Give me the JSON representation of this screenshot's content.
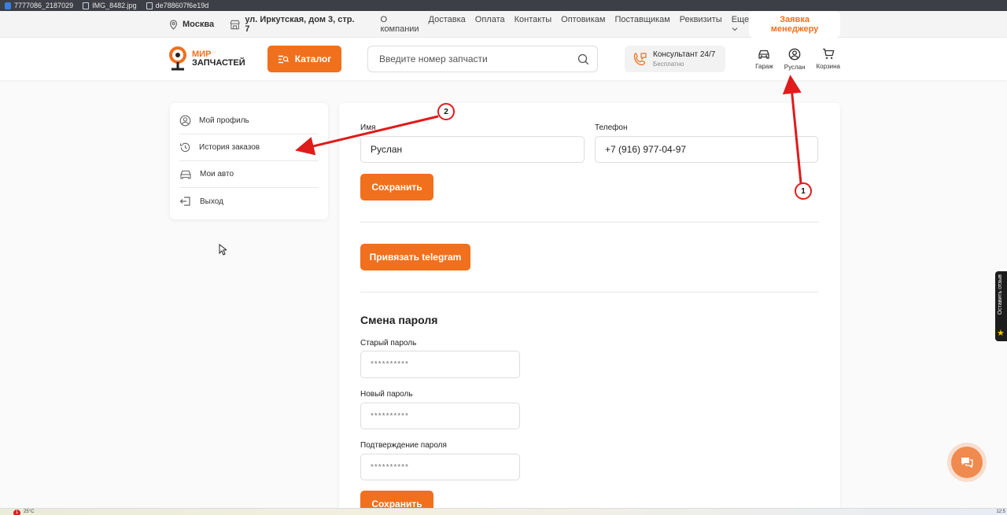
{
  "browser_tabs": [
    {
      "label": "7777086_2187029",
      "icon": "app-icon"
    },
    {
      "label": "IMG_8482.jpg",
      "icon": "file-icon"
    },
    {
      "label": "de788607f6e19d",
      "icon": "file-icon"
    }
  ],
  "topbar": {
    "city": "Москва",
    "address": "ул. Иркутская, дом 3, стр. 7",
    "links": [
      "О компании",
      "Доставка",
      "Оплата",
      "Контакты",
      "Оптовикам",
      "Поставщикам",
      "Реквизиты",
      "Еще"
    ],
    "manager_button": "Заявка менеджеру"
  },
  "header": {
    "logo_line1": "МИР",
    "logo_line2": "ЗАПЧАСТЕЙ",
    "catalog_button": "Каталог",
    "search_placeholder": "Введите номер запчасти",
    "consultant_title": "Консультант 24/7",
    "consultant_subtitle": "Бесплатно",
    "garage_label": "Гараж",
    "user_label": "Руслан",
    "cart_label": "Корзина"
  },
  "sidebar": {
    "items": [
      {
        "label": "Мой профиль",
        "icon": "user-icon"
      },
      {
        "label": "История заказов",
        "icon": "history-icon"
      },
      {
        "label": "Мои авто",
        "icon": "car-icon"
      },
      {
        "label": "Выход",
        "icon": "logout-icon"
      }
    ]
  },
  "profile_form": {
    "name_label": "Имя",
    "name_value": "Руслан",
    "phone_label": "Телефон",
    "phone_value": "+7 (916) 977-04-97",
    "save_button": "Сохранить",
    "telegram_button": "Привязать telegram"
  },
  "password_form": {
    "title": "Смена пароля",
    "old_label": "Старый пароль",
    "old_placeholder": "**********",
    "new_label": "Новый пароль",
    "new_placeholder": "**********",
    "confirm_label": "Подтверждение пароля",
    "confirm_placeholder": "**********",
    "save_button": "Сохранить"
  },
  "feedback_tab": "Оставить отзыв",
  "annotations": {
    "first": "1",
    "second": "2"
  },
  "taskbar": {
    "notification_count": "1",
    "temperature": "25°C",
    "time": "12:5"
  },
  "colors": {
    "accent": "#f0701d",
    "annotation": "#e01b1b"
  }
}
